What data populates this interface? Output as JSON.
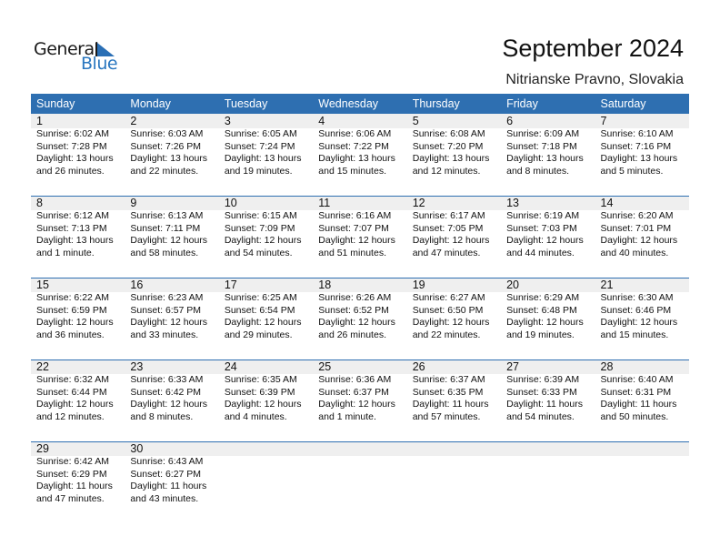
{
  "logo": {
    "word1": "General",
    "word2": "Blue",
    "icon": "triangle-flag-icon"
  },
  "header": {
    "title": "September 2024",
    "location": "Nitrianske Pravno, Slovakia"
  },
  "colors": {
    "accent": "#2e6fb1",
    "stripe": "#efefef",
    "logo_blue": "#2a77c0"
  },
  "weekdays": [
    "Sunday",
    "Monday",
    "Tuesday",
    "Wednesday",
    "Thursday",
    "Friday",
    "Saturday"
  ],
  "weeks": [
    [
      {
        "day": "1",
        "sunrise": "Sunrise: 6:02 AM",
        "sunset": "Sunset: 7:28 PM",
        "daylight1": "Daylight: 13 hours",
        "daylight2": "and 26 minutes."
      },
      {
        "day": "2",
        "sunrise": "Sunrise: 6:03 AM",
        "sunset": "Sunset: 7:26 PM",
        "daylight1": "Daylight: 13 hours",
        "daylight2": "and 22 minutes."
      },
      {
        "day": "3",
        "sunrise": "Sunrise: 6:05 AM",
        "sunset": "Sunset: 7:24 PM",
        "daylight1": "Daylight: 13 hours",
        "daylight2": "and 19 minutes."
      },
      {
        "day": "4",
        "sunrise": "Sunrise: 6:06 AM",
        "sunset": "Sunset: 7:22 PM",
        "daylight1": "Daylight: 13 hours",
        "daylight2": "and 15 minutes."
      },
      {
        "day": "5",
        "sunrise": "Sunrise: 6:08 AM",
        "sunset": "Sunset: 7:20 PM",
        "daylight1": "Daylight: 13 hours",
        "daylight2": "and 12 minutes."
      },
      {
        "day": "6",
        "sunrise": "Sunrise: 6:09 AM",
        "sunset": "Sunset: 7:18 PM",
        "daylight1": "Daylight: 13 hours",
        "daylight2": "and 8 minutes."
      },
      {
        "day": "7",
        "sunrise": "Sunrise: 6:10 AM",
        "sunset": "Sunset: 7:16 PM",
        "daylight1": "Daylight: 13 hours",
        "daylight2": "and 5 minutes."
      }
    ],
    [
      {
        "day": "8",
        "sunrise": "Sunrise: 6:12 AM",
        "sunset": "Sunset: 7:13 PM",
        "daylight1": "Daylight: 13 hours",
        "daylight2": "and 1 minute."
      },
      {
        "day": "9",
        "sunrise": "Sunrise: 6:13 AM",
        "sunset": "Sunset: 7:11 PM",
        "daylight1": "Daylight: 12 hours",
        "daylight2": "and 58 minutes."
      },
      {
        "day": "10",
        "sunrise": "Sunrise: 6:15 AM",
        "sunset": "Sunset: 7:09 PM",
        "daylight1": "Daylight: 12 hours",
        "daylight2": "and 54 minutes."
      },
      {
        "day": "11",
        "sunrise": "Sunrise: 6:16 AM",
        "sunset": "Sunset: 7:07 PM",
        "daylight1": "Daylight: 12 hours",
        "daylight2": "and 51 minutes."
      },
      {
        "day": "12",
        "sunrise": "Sunrise: 6:17 AM",
        "sunset": "Sunset: 7:05 PM",
        "daylight1": "Daylight: 12 hours",
        "daylight2": "and 47 minutes."
      },
      {
        "day": "13",
        "sunrise": "Sunrise: 6:19 AM",
        "sunset": "Sunset: 7:03 PM",
        "daylight1": "Daylight: 12 hours",
        "daylight2": "and 44 minutes."
      },
      {
        "day": "14",
        "sunrise": "Sunrise: 6:20 AM",
        "sunset": "Sunset: 7:01 PM",
        "daylight1": "Daylight: 12 hours",
        "daylight2": "and 40 minutes."
      }
    ],
    [
      {
        "day": "15",
        "sunrise": "Sunrise: 6:22 AM",
        "sunset": "Sunset: 6:59 PM",
        "daylight1": "Daylight: 12 hours",
        "daylight2": "and 36 minutes."
      },
      {
        "day": "16",
        "sunrise": "Sunrise: 6:23 AM",
        "sunset": "Sunset: 6:57 PM",
        "daylight1": "Daylight: 12 hours",
        "daylight2": "and 33 minutes."
      },
      {
        "day": "17",
        "sunrise": "Sunrise: 6:25 AM",
        "sunset": "Sunset: 6:54 PM",
        "daylight1": "Daylight: 12 hours",
        "daylight2": "and 29 minutes."
      },
      {
        "day": "18",
        "sunrise": "Sunrise: 6:26 AM",
        "sunset": "Sunset: 6:52 PM",
        "daylight1": "Daylight: 12 hours",
        "daylight2": "and 26 minutes."
      },
      {
        "day": "19",
        "sunrise": "Sunrise: 6:27 AM",
        "sunset": "Sunset: 6:50 PM",
        "daylight1": "Daylight: 12 hours",
        "daylight2": "and 22 minutes."
      },
      {
        "day": "20",
        "sunrise": "Sunrise: 6:29 AM",
        "sunset": "Sunset: 6:48 PM",
        "daylight1": "Daylight: 12 hours",
        "daylight2": "and 19 minutes."
      },
      {
        "day": "21",
        "sunrise": "Sunrise: 6:30 AM",
        "sunset": "Sunset: 6:46 PM",
        "daylight1": "Daylight: 12 hours",
        "daylight2": "and 15 minutes."
      }
    ],
    [
      {
        "day": "22",
        "sunrise": "Sunrise: 6:32 AM",
        "sunset": "Sunset: 6:44 PM",
        "daylight1": "Daylight: 12 hours",
        "daylight2": "and 12 minutes."
      },
      {
        "day": "23",
        "sunrise": "Sunrise: 6:33 AM",
        "sunset": "Sunset: 6:42 PM",
        "daylight1": "Daylight: 12 hours",
        "daylight2": "and 8 minutes."
      },
      {
        "day": "24",
        "sunrise": "Sunrise: 6:35 AM",
        "sunset": "Sunset: 6:39 PM",
        "daylight1": "Daylight: 12 hours",
        "daylight2": "and 4 minutes."
      },
      {
        "day": "25",
        "sunrise": "Sunrise: 6:36 AM",
        "sunset": "Sunset: 6:37 PM",
        "daylight1": "Daylight: 12 hours",
        "daylight2": "and 1 minute."
      },
      {
        "day": "26",
        "sunrise": "Sunrise: 6:37 AM",
        "sunset": "Sunset: 6:35 PM",
        "daylight1": "Daylight: 11 hours",
        "daylight2": "and 57 minutes."
      },
      {
        "day": "27",
        "sunrise": "Sunrise: 6:39 AM",
        "sunset": "Sunset: 6:33 PM",
        "daylight1": "Daylight: 11 hours",
        "daylight2": "and 54 minutes."
      },
      {
        "day": "28",
        "sunrise": "Sunrise: 6:40 AM",
        "sunset": "Sunset: 6:31 PM",
        "daylight1": "Daylight: 11 hours",
        "daylight2": "and 50 minutes."
      }
    ],
    [
      {
        "day": "29",
        "sunrise": "Sunrise: 6:42 AM",
        "sunset": "Sunset: 6:29 PM",
        "daylight1": "Daylight: 11 hours",
        "daylight2": "and 47 minutes."
      },
      {
        "day": "30",
        "sunrise": "Sunrise: 6:43 AM",
        "sunset": "Sunset: 6:27 PM",
        "daylight1": "Daylight: 11 hours",
        "daylight2": "and 43 minutes."
      },
      {},
      {},
      {},
      {},
      {}
    ]
  ]
}
